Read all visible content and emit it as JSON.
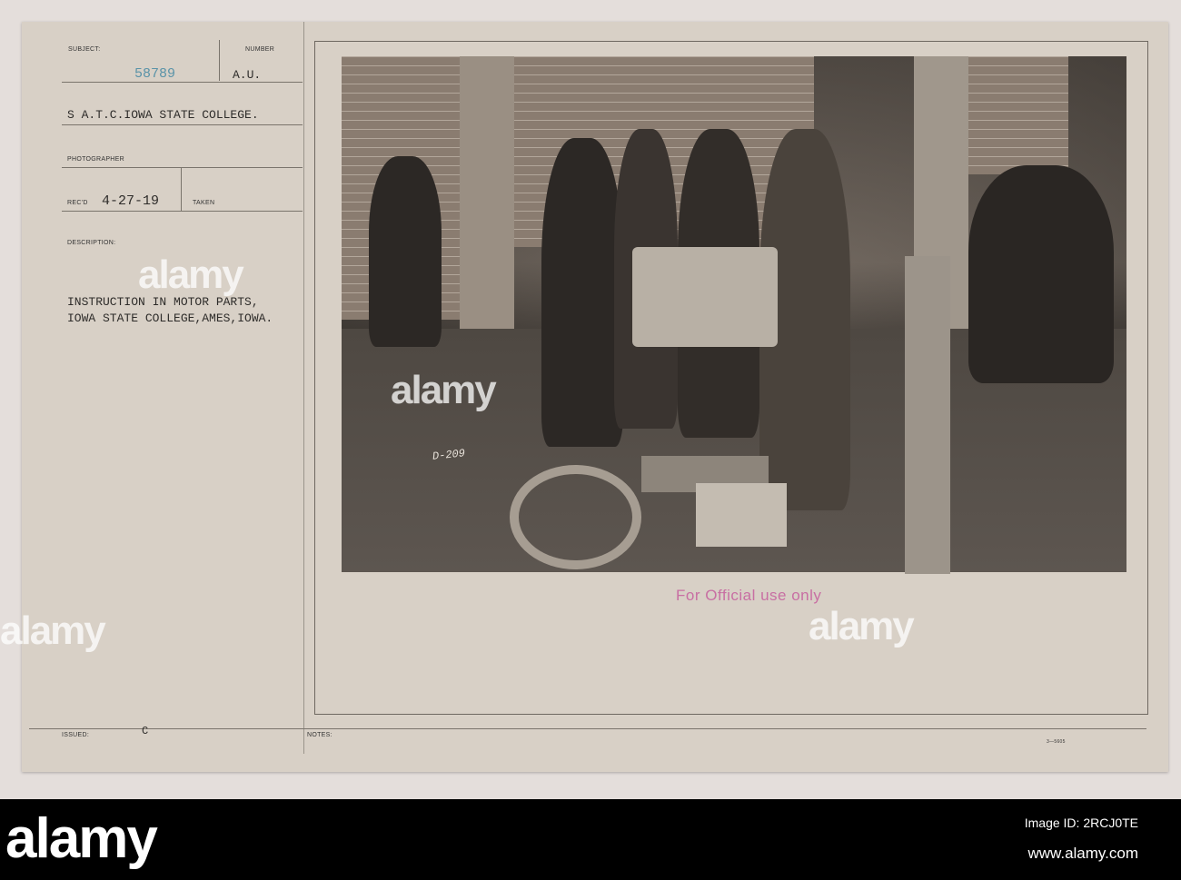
{
  "card": {
    "subject_label": "SUBJECT:",
    "number_label": "NUMBER",
    "number_value": "58789",
    "unit": "A.U.",
    "subject": "S A.T.C.IOWA STATE COLLEGE.",
    "photographer_label": "PHOTOGRAPHER",
    "recd_label": "REC'D",
    "recd_date": "4-27-19",
    "taken_label": "TAKEN",
    "description_label": "DESCRIPTION:",
    "description_line1": "INSTRUCTION IN MOTOR PARTS,",
    "description_line2": "IOWA STATE COLLEGE,AMES,IOWA.",
    "issued_label": "ISSUED:",
    "issued_value": "C",
    "notes_label": "NOTES:",
    "form_code": "3—5605"
  },
  "photo": {
    "plate_label": "D-209",
    "stamp": "For Official use only",
    "stamp_color": "#c86fa3"
  },
  "watermark": {
    "brand": "alamy",
    "image_id": "Image ID: 2RCJ0TE",
    "url": "www.alamy.com"
  }
}
